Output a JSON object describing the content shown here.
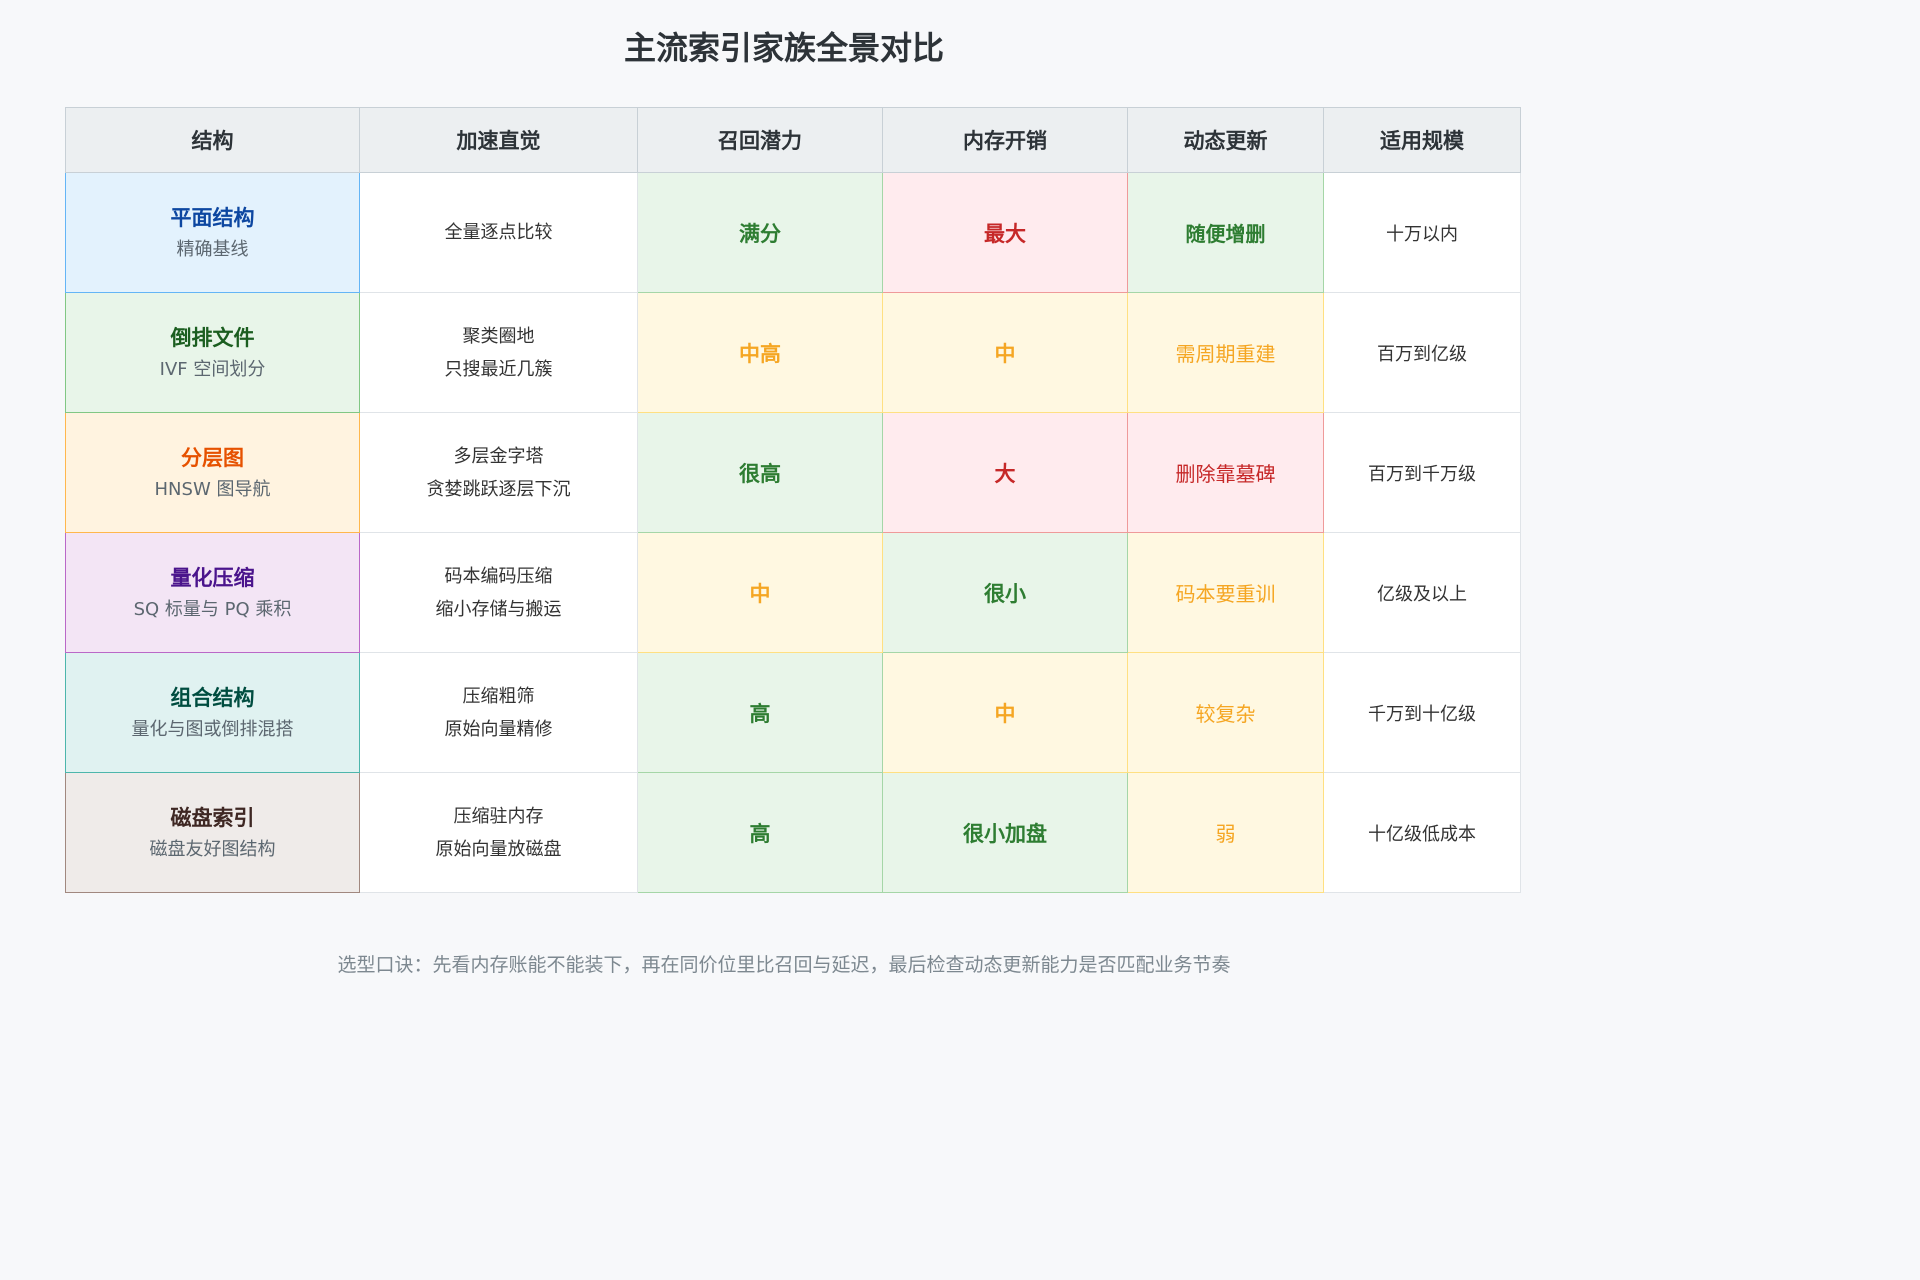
{
  "title": "主流索引家族全景对比",
  "headers": [
    "结构",
    "加速直觉",
    "召回潜力",
    "内存开销",
    "动态更新",
    "适用规模"
  ],
  "rows": [
    {
      "name": "平面结构",
      "sub": "精确基线",
      "intuition": [
        "全量逐点比较"
      ],
      "recall": {
        "text": "满分",
        "level": "good"
      },
      "memory": {
        "text": "最大",
        "level": "bad"
      },
      "update": {
        "text": "随便增删",
        "level": "good"
      },
      "scale": "十万以内",
      "colors": {
        "bg": "#e3f2fd",
        "name": "#0d47a1",
        "edge": "#64b5f6"
      }
    },
    {
      "name": "倒排文件",
      "sub": "IVF 空间划分",
      "intuition": [
        "聚类圈地",
        "只搜最近几簇"
      ],
      "recall": {
        "text": "中高",
        "level": "mid"
      },
      "memory": {
        "text": "中",
        "level": "mid"
      },
      "update": {
        "text": "需周期重建",
        "level": "mid"
      },
      "scale": "百万到亿级",
      "colors": {
        "bg": "#e8f5e9",
        "name": "#1b5e20",
        "edge": "#81c784"
      }
    },
    {
      "name": "分层图",
      "sub": "HNSW 图导航",
      "intuition": [
        "多层金字塔",
        "贪婪跳跃逐层下沉"
      ],
      "recall": {
        "text": "很高",
        "level": "good"
      },
      "memory": {
        "text": "大",
        "level": "bad"
      },
      "update": {
        "text": "删除靠墓碑",
        "level": "bad"
      },
      "scale": "百万到千万级",
      "colors": {
        "bg": "#fff3e0",
        "name": "#e65100",
        "edge": "#ffb74d"
      }
    },
    {
      "name": "量化压缩",
      "sub": "SQ 标量与 PQ 乘积",
      "intuition": [
        "码本编码压缩",
        "缩小存储与搬运"
      ],
      "recall": {
        "text": "中",
        "level": "mid"
      },
      "memory": {
        "text": "很小",
        "level": "good"
      },
      "update": {
        "text": "码本要重训",
        "level": "mid"
      },
      "scale": "亿级及以上",
      "colors": {
        "bg": "#f3e5f5",
        "name": "#4a148c",
        "edge": "#ba68c8"
      }
    },
    {
      "name": "组合结构",
      "sub": "量化与图或倒排混搭",
      "intuition": [
        "压缩粗筛",
        "原始向量精修"
      ],
      "recall": {
        "text": "高",
        "level": "good"
      },
      "memory": {
        "text": "中",
        "level": "mid"
      },
      "update": {
        "text": "较复杂",
        "level": "mid"
      },
      "scale": "千万到十亿级",
      "colors": {
        "bg": "#e0f2f1",
        "name": "#004d40",
        "edge": "#4db6ac"
      }
    },
    {
      "name": "磁盘索引",
      "sub": "磁盘友好图结构",
      "intuition": [
        "压缩驻内存",
        "原始向量放磁盘"
      ],
      "recall": {
        "text": "高",
        "level": "good"
      },
      "memory": {
        "text": "很小加盘",
        "level": "good"
      },
      "update": {
        "text": "弱",
        "level": "mid"
      },
      "scale": "十亿级低成本",
      "colors": {
        "bg": "#efebe9",
        "name": "#3e2723",
        "edge": "#a1887f"
      }
    }
  ],
  "level_colors": {
    "good": {
      "bg": "#e8f5e9",
      "text": "#2e7d32",
      "edge": "#a5d6a7"
    },
    "mid": {
      "bg": "#fff8e1",
      "text": "#f5a623",
      "edge": "#ffe082"
    },
    "bad": {
      "bg": "#ffebee",
      "text": "#c62828",
      "edge": "#ef9a9a"
    }
  },
  "footer": "选型口诀：先看内存账能不能装下，再在同价位里比召回与延迟，最后检查动态更新能力是否匹配业务节奏"
}
